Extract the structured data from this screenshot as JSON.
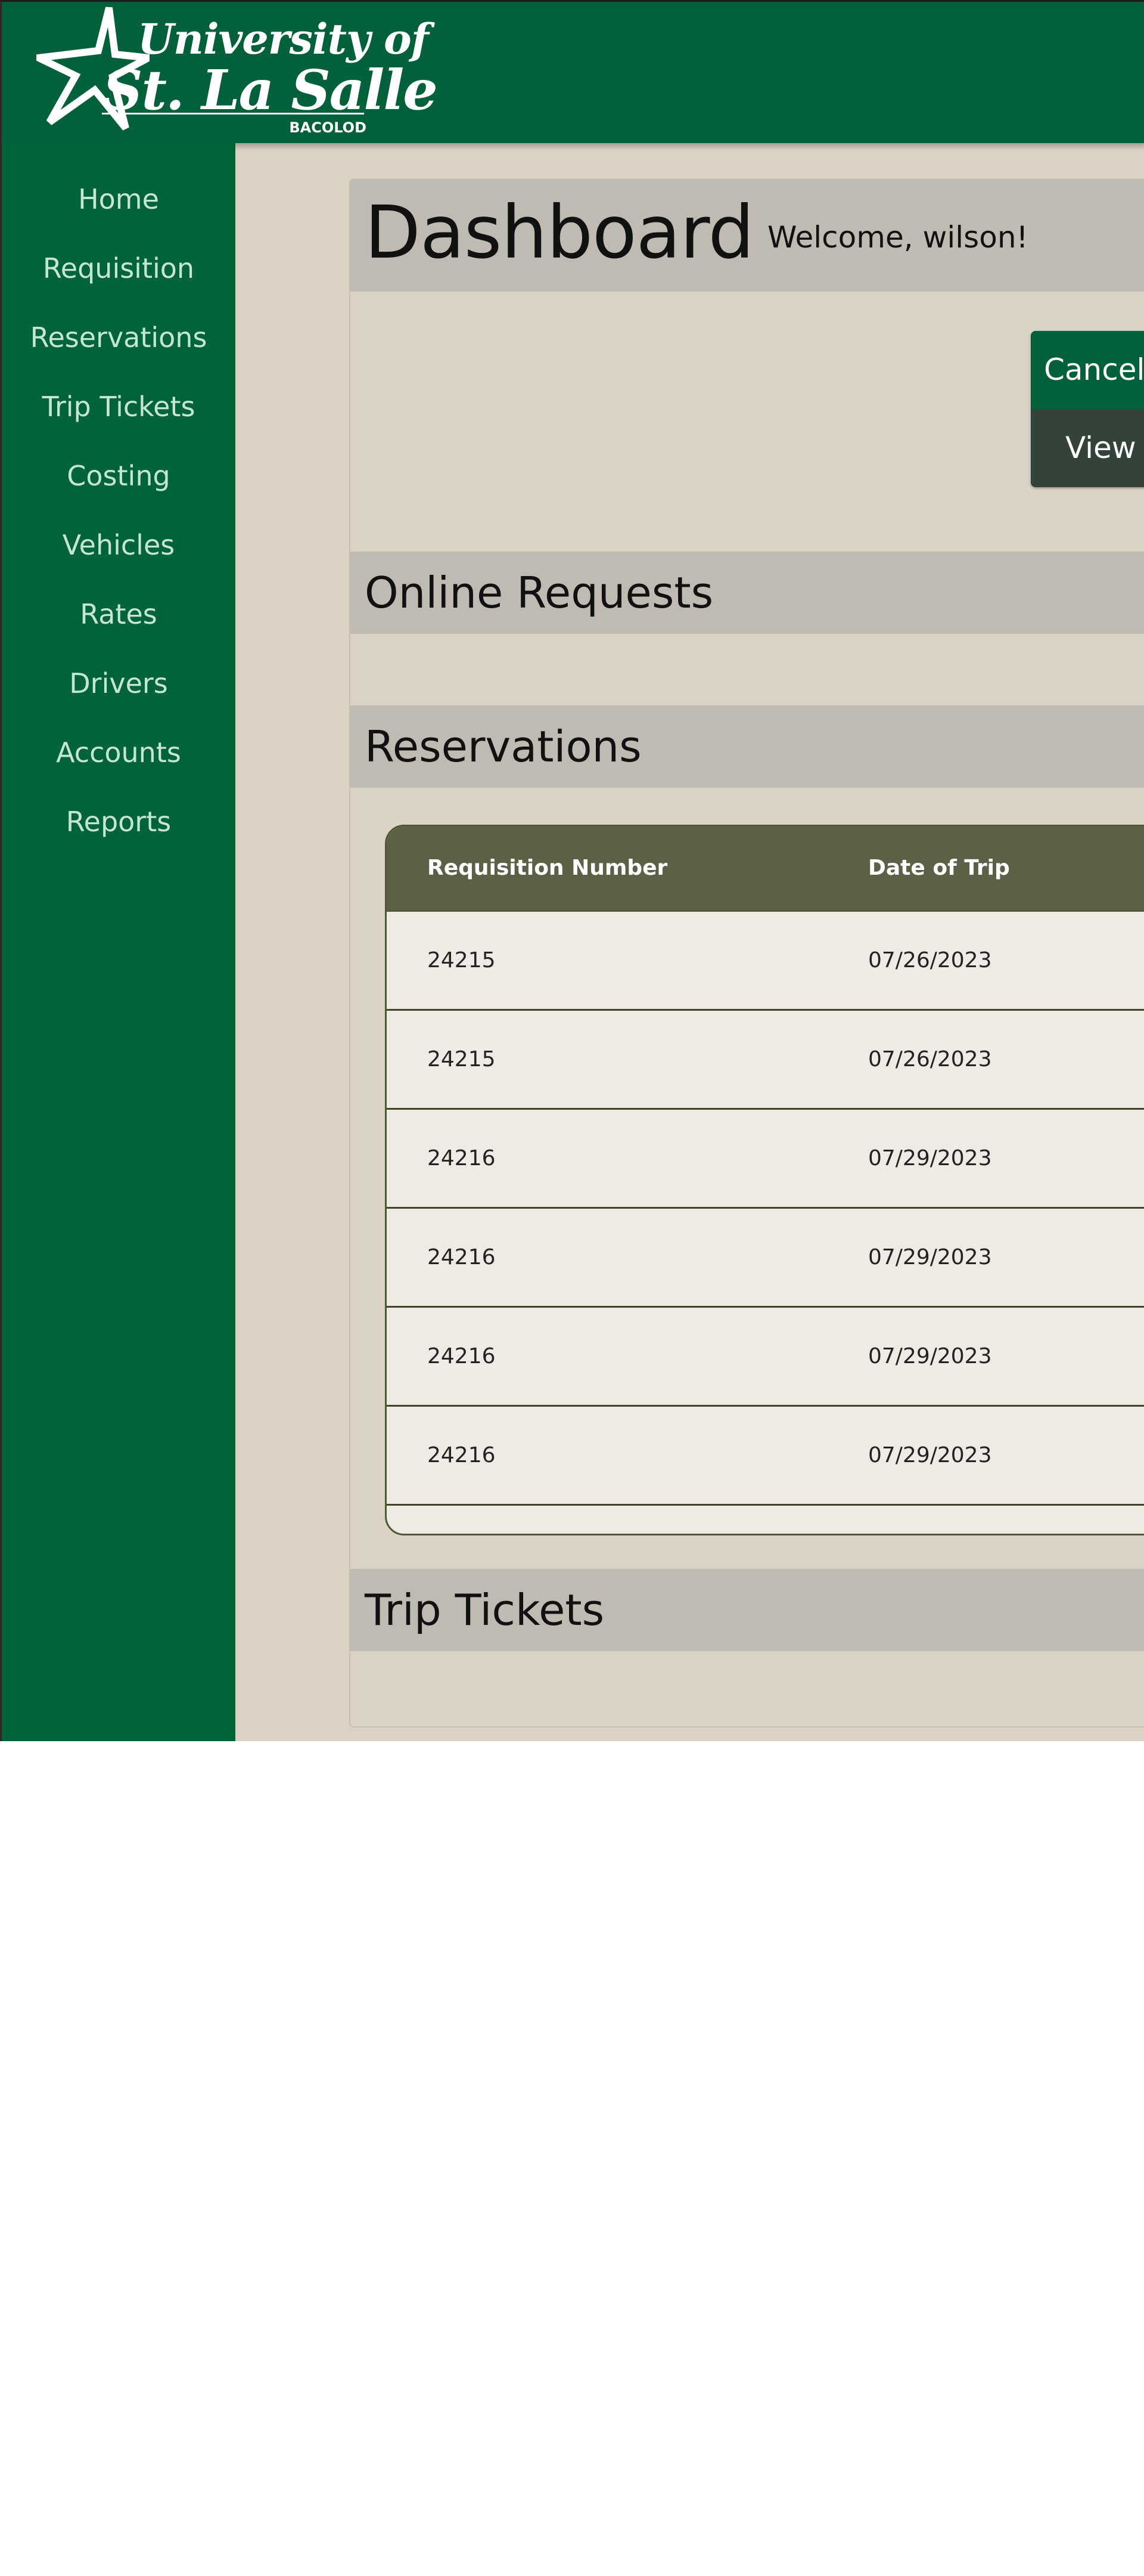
{
  "brand": {
    "line1": "University of",
    "line2": "St. La Salle",
    "sub": "BACOLOD"
  },
  "sidebar": {
    "items": [
      {
        "label": "Home"
      },
      {
        "label": "Requisition"
      },
      {
        "label": "Reservations"
      },
      {
        "label": "Trip Tickets"
      },
      {
        "label": "Costing"
      },
      {
        "label": "Vehicles"
      },
      {
        "label": "Rates"
      },
      {
        "label": "Drivers"
      },
      {
        "label": "Accounts"
      },
      {
        "label": "Reports"
      }
    ]
  },
  "dashboard": {
    "title": "Dashboard",
    "welcome": "Welcome, wilson!"
  },
  "buttons": {
    "cancel_label": "Cancele",
    "view_label": "View D"
  },
  "sections": {
    "online_requests": "Online Requests",
    "reservations": "Reservations",
    "trip_tickets": "Trip Tickets"
  },
  "reservations_table": {
    "headers": [
      "Requisition Number",
      "Date of Trip"
    ],
    "rows": [
      [
        "24215",
        "07/26/2023"
      ],
      [
        "24215",
        "07/26/2023"
      ],
      [
        "24216",
        "07/29/2023"
      ],
      [
        "24216",
        "07/29/2023"
      ],
      [
        "24216",
        "07/29/2023"
      ],
      [
        "24216",
        "07/29/2023"
      ]
    ]
  },
  "colors": {
    "brand_green": "#02613b",
    "sidebar_green": "#006438",
    "content_bg": "#dbd2c3",
    "section_bar": "#c0bbb2",
    "table_header": "#5d5f47",
    "row_bg": "#efebe4",
    "view_button": "#34433a"
  }
}
